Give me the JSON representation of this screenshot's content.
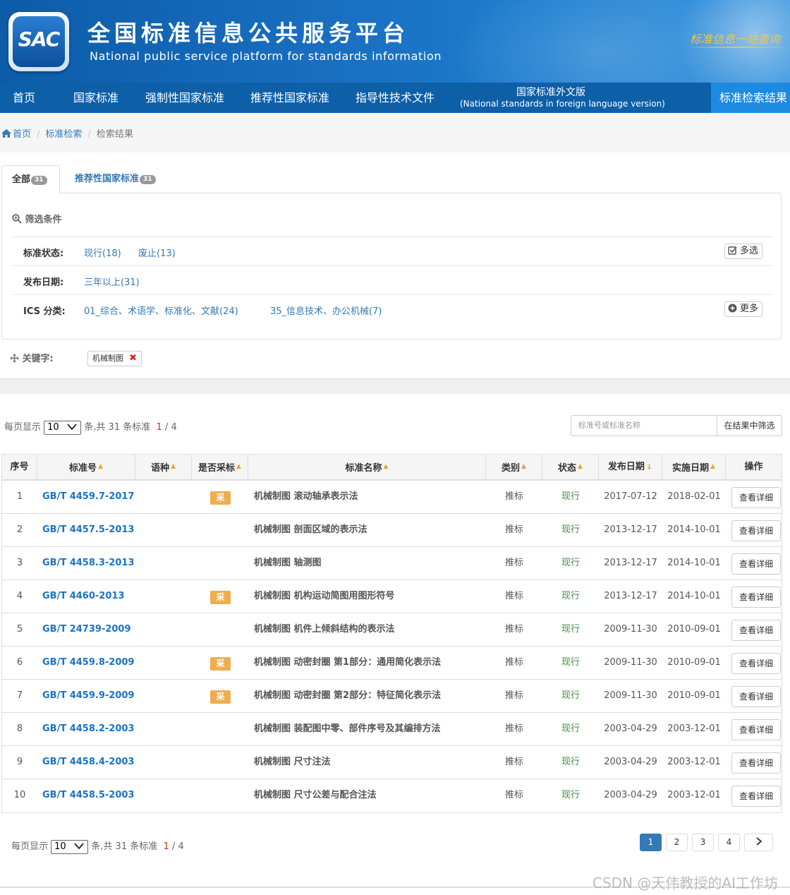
{
  "header": {
    "logo_text": "SAC",
    "title_cn": "全国标准信息公共服务平台",
    "title_en": "National public service platform  for standards information",
    "slogan": "标准信息一站查询"
  },
  "nav": {
    "items": [
      "首页",
      "国家标准",
      "强制性国家标准",
      "推荐性国家标准",
      "指导性技术文件"
    ],
    "foreign_line1": "国家标准外文版",
    "foreign_line2": "(National standards in foreign language version)",
    "active": "标准检索结果"
  },
  "breadcrumb": {
    "home": "首页",
    "search": "标准检索",
    "current": "检索结果"
  },
  "tabs": [
    {
      "label": "全部",
      "count": "31"
    },
    {
      "label": "推荐性国家标准",
      "count": "31"
    }
  ],
  "filters": {
    "heading": "筛选条件",
    "status_label": "标准状态:",
    "status_options": [
      "现行(18)",
      "废止(13)"
    ],
    "multi_select": "多选",
    "date_label": "发布日期:",
    "date_options": [
      "三年以上(31)"
    ],
    "ics_label": "ICS 分类:",
    "ics_options": [
      "01_综合、术语学、标准化、文献(24)",
      "35_信息技术、办公机械(7)"
    ],
    "more": "更多"
  },
  "keyword": {
    "label": "关键字:",
    "tag": "机械制图"
  },
  "pagination_top": {
    "per_page_label": "每页显示",
    "per_page_value": "10",
    "total_text": "条,共 31 条标准",
    "current_page": "1",
    "total_pages": " / 4"
  },
  "search": {
    "placeholder": "标准号或标准名称",
    "button": "在结果中筛选"
  },
  "table": {
    "headers": [
      "序号",
      "标准号",
      "语种",
      "是否采标",
      "标准名称",
      "类别",
      "状态",
      "发布日期",
      "实施日期",
      "操作"
    ],
    "rows": [
      {
        "no": "1",
        "code": "GB/T 4459.7-2017",
        "cai": true,
        "name": "机械制图 滚动轴承表示法",
        "cat": "推标",
        "status": "现行",
        "pub": "2017-07-12",
        "impl": "2018-02-01"
      },
      {
        "no": "2",
        "code": "GB/T 4457.5-2013",
        "cai": false,
        "name": "机械制图 剖面区域的表示法",
        "cat": "推标",
        "status": "现行",
        "pub": "2013-12-17",
        "impl": "2014-10-01"
      },
      {
        "no": "3",
        "code": "GB/T 4458.3-2013",
        "cai": false,
        "name": "机械制图 轴测图",
        "cat": "推标",
        "status": "现行",
        "pub": "2013-12-17",
        "impl": "2014-10-01"
      },
      {
        "no": "4",
        "code": "GB/T 4460-2013",
        "cai": true,
        "name": "机械制图 机构运动简图用图形符号",
        "cat": "推标",
        "status": "现行",
        "pub": "2013-12-17",
        "impl": "2014-10-01"
      },
      {
        "no": "5",
        "code": "GB/T 24739-2009",
        "cai": false,
        "name": "机械制图 机件上倾斜结构的表示法",
        "cat": "推标",
        "status": "现行",
        "pub": "2009-11-30",
        "impl": "2010-09-01"
      },
      {
        "no": "6",
        "code": "GB/T 4459.8-2009",
        "cai": true,
        "name": "机械制图 动密封圈 第1部分：通用简化表示法",
        "cat": "推标",
        "status": "现行",
        "pub": "2009-11-30",
        "impl": "2010-09-01"
      },
      {
        "no": "7",
        "code": "GB/T 4459.9-2009",
        "cai": true,
        "name": "机械制图 动密封圈 第2部分：特征简化表示法",
        "cat": "推标",
        "status": "现行",
        "pub": "2009-11-30",
        "impl": "2010-09-01"
      },
      {
        "no": "8",
        "code": "GB/T 4458.2-2003",
        "cai": false,
        "name": "机械制图 装配图中零、部件序号及其编排方法",
        "cat": "推标",
        "status": "现行",
        "pub": "2003-04-29",
        "impl": "2003-12-01"
      },
      {
        "no": "9",
        "code": "GB/T 4458.4-2003",
        "cai": false,
        "name": "机械制图 尺寸注法",
        "cat": "推标",
        "status": "现行",
        "pub": "2003-04-29",
        "impl": "2003-12-01"
      },
      {
        "no": "10",
        "code": "GB/T 4458.5-2003",
        "cai": false,
        "name": "机械制图 尺寸公差与配合注法",
        "cat": "推标",
        "status": "现行",
        "pub": "2003-04-29",
        "impl": "2003-12-01"
      }
    ],
    "cai_label": "采",
    "detail_label": "查看详细"
  },
  "pagination_bottom": {
    "per_page_label": "每页显示",
    "per_page_value": "10",
    "total_text": "条,共 31 条标准",
    "current_page": "1",
    "total_pages": " / 4",
    "pages": [
      "1",
      "2",
      "3",
      "4"
    ]
  },
  "watermark": "CSDN @天伟教授的AI工作坊"
}
